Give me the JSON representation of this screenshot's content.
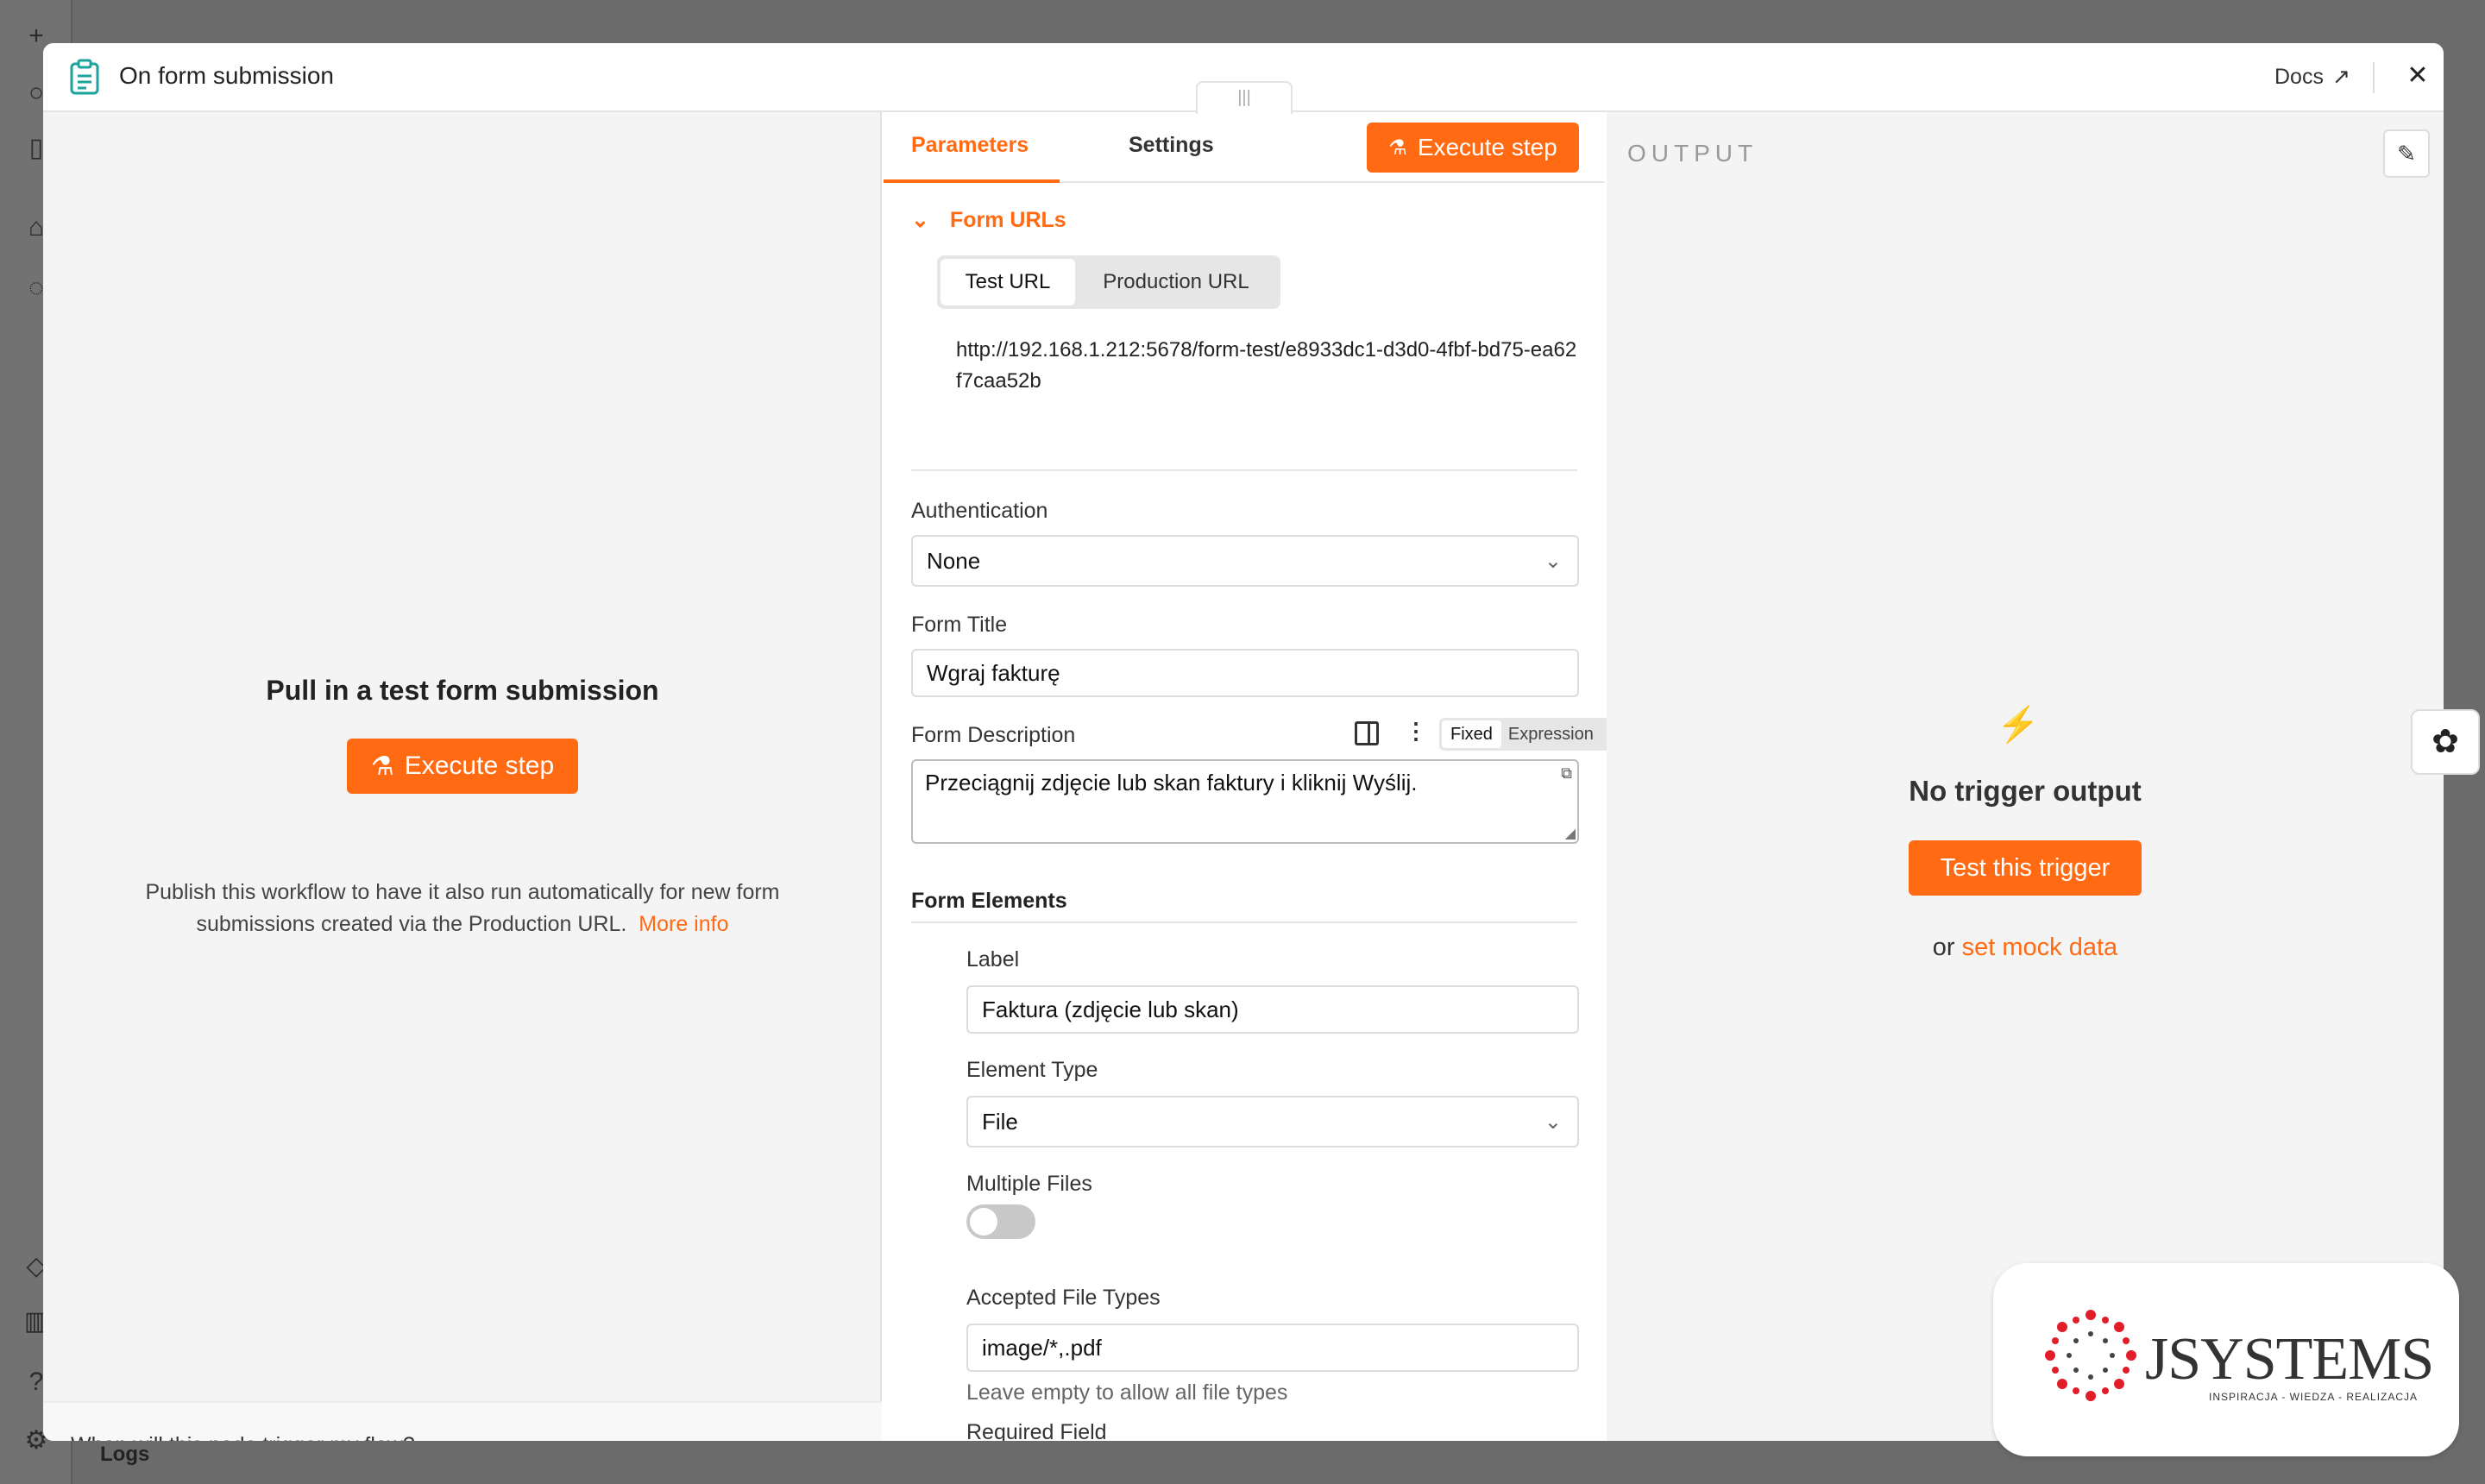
{
  "header": {
    "title": "On form submission",
    "docs_label": "Docs",
    "close_icon": "close-icon"
  },
  "left_panel": {
    "title": "Pull in a test form submission",
    "execute_label": "Execute step",
    "description": "Publish this workflow to have it also run automatically for new form submissions created via the Production URL.",
    "more_info": "More info",
    "footer": "When will this node trigger my flow?"
  },
  "tabs": {
    "parameters": "Parameters",
    "settings": "Settings",
    "execute_label": "Execute step"
  },
  "form_urls": {
    "section_label": "Form URLs",
    "test_tab": "Test URL",
    "production_tab": "Production URL",
    "url": "http://192.168.1.212:5678/form-test/e8933dc1-d3d0-4fbf-bd75-ea62f7caa52b"
  },
  "authentication": {
    "label": "Authentication",
    "value": "None"
  },
  "form_title": {
    "label": "Form Title",
    "value": "Wgraj fakturę"
  },
  "form_description": {
    "label": "Form Description",
    "mode_fixed": "Fixed",
    "mode_expression": "Expression",
    "value": "Przeciągnij zdjęcie lub skan faktury i kliknij Wyślij."
  },
  "form_elements": {
    "label": "Form Elements",
    "element_label_label": "Label",
    "element_label_value": "Faktura (zdjęcie lub skan)",
    "element_type_label": "Element Type",
    "element_type_value": "File",
    "multiple_files_label": "Multiple Files",
    "multiple_files_on": false,
    "accepted_label": "Accepted File Types",
    "accepted_value": "image/*,.pdf",
    "accepted_hint": "Leave empty to allow all file types",
    "required_label": "Required Field",
    "required_on": true
  },
  "output": {
    "title": "OUTPUT",
    "no_output": "No trigger output",
    "test_button": "Test this trigger",
    "or_text": "or",
    "mock_link": "set mock data"
  },
  "background": {
    "logs_label": "Logs"
  },
  "brand": {
    "name": "JSYSTEMS",
    "tagline": "INSPIRACJA - WIEDZA - REALIZACJA"
  },
  "colors": {
    "accent": "#ff6a13",
    "toggle_on": "#22c55e",
    "toggle_off": "#c8c8c8",
    "header_icon": "#1ba39c"
  }
}
